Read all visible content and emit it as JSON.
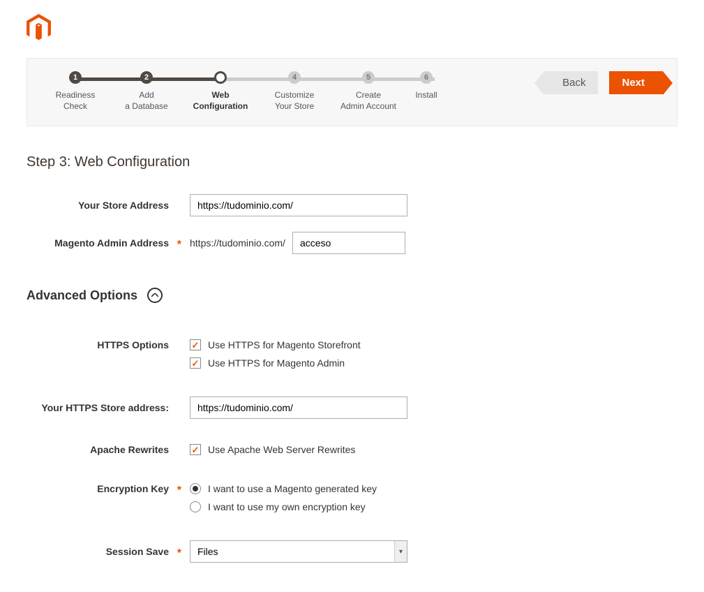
{
  "steps": [
    {
      "num": "1",
      "label1": "Readiness",
      "label2": "Check",
      "state": "done"
    },
    {
      "num": "2",
      "label1": "Add",
      "label2": "a Database",
      "state": "done"
    },
    {
      "num": "3",
      "label1": "Web",
      "label2": "Configuration",
      "state": "active"
    },
    {
      "num": "4",
      "label1": "Customize",
      "label2": "Your Store",
      "state": "pending"
    },
    {
      "num": "5",
      "label1": "Create",
      "label2": "Admin Account",
      "state": "pending"
    },
    {
      "num": "6",
      "label1": "Install",
      "label2": "",
      "state": "pending"
    }
  ],
  "nav": {
    "back": "Back",
    "next": "Next"
  },
  "page": {
    "title": "Step 3: Web Configuration",
    "store_address_label": "Your Store Address",
    "store_address_value": "https://tudominio.com/",
    "admin_address_label": "Magento Admin Address",
    "admin_prefix": "https://tudominio.com/",
    "admin_value": "acceso"
  },
  "advanced": {
    "title": "Advanced Options",
    "https_label": "HTTPS Options",
    "https_storefront": "Use HTTPS for Magento Storefront",
    "https_admin": "Use HTTPS for Magento Admin",
    "https_store_label": "Your HTTPS Store address:",
    "https_store_value": "https://tudominio.com/",
    "apache_label": "Apache Rewrites",
    "apache_check": "Use Apache Web Server Rewrites",
    "enc_label": "Encryption Key",
    "enc_magento": "I want to use a Magento generated key",
    "enc_own": "I want to use my own encryption key",
    "session_label": "Session Save",
    "session_value": "Files"
  }
}
